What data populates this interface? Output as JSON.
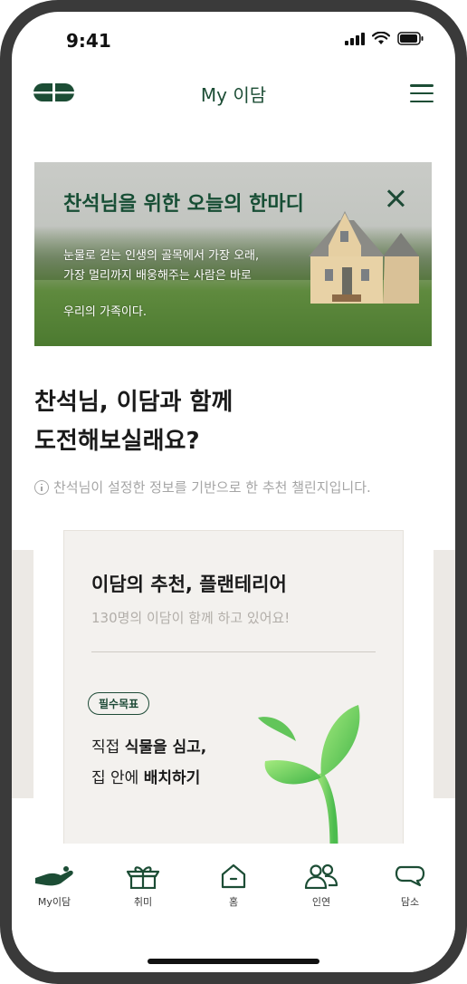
{
  "status": {
    "time": "9:41"
  },
  "header": {
    "title": "My 이담"
  },
  "banner": {
    "title": "찬석님을 위한 오늘의 한마디",
    "lines": [
      "눈물로 걷는 인생의 골목에서 가장 오래,",
      "가장 멀리까지 배웅해주는 사람은 바로",
      "우리의 가족이다."
    ]
  },
  "main": {
    "headline_line1": "찬석님, 이담과 함께",
    "headline_line2": "도전해보실래요?",
    "info_text": "찬석님이 설정한 정보를 기반으로 한 추천 챌린지입니다."
  },
  "card": {
    "title": "이담의 추천, 플랜테리어",
    "subtitle": "130명의 이담이 함께 하고 있어요!",
    "tag": "필수목표",
    "line1_prefix": "직접 ",
    "line1_bold": "식물을 심고,",
    "line2_prefix": "집 안에 ",
    "line2_bold": "배치하기"
  },
  "nav": {
    "items": [
      {
        "label": "My이담",
        "icon": "hand-heart-icon"
      },
      {
        "label": "취미",
        "icon": "gift-box-icon"
      },
      {
        "label": "홈",
        "icon": "home-icon"
      },
      {
        "label": "인연",
        "icon": "people-icon"
      },
      {
        "label": "담소",
        "icon": "chat-bubble-icon"
      }
    ]
  },
  "colors": {
    "brand": "#1c4d35",
    "background": "#ffffff",
    "card": "#f3f1ee",
    "muted": "#a5a5a5"
  }
}
